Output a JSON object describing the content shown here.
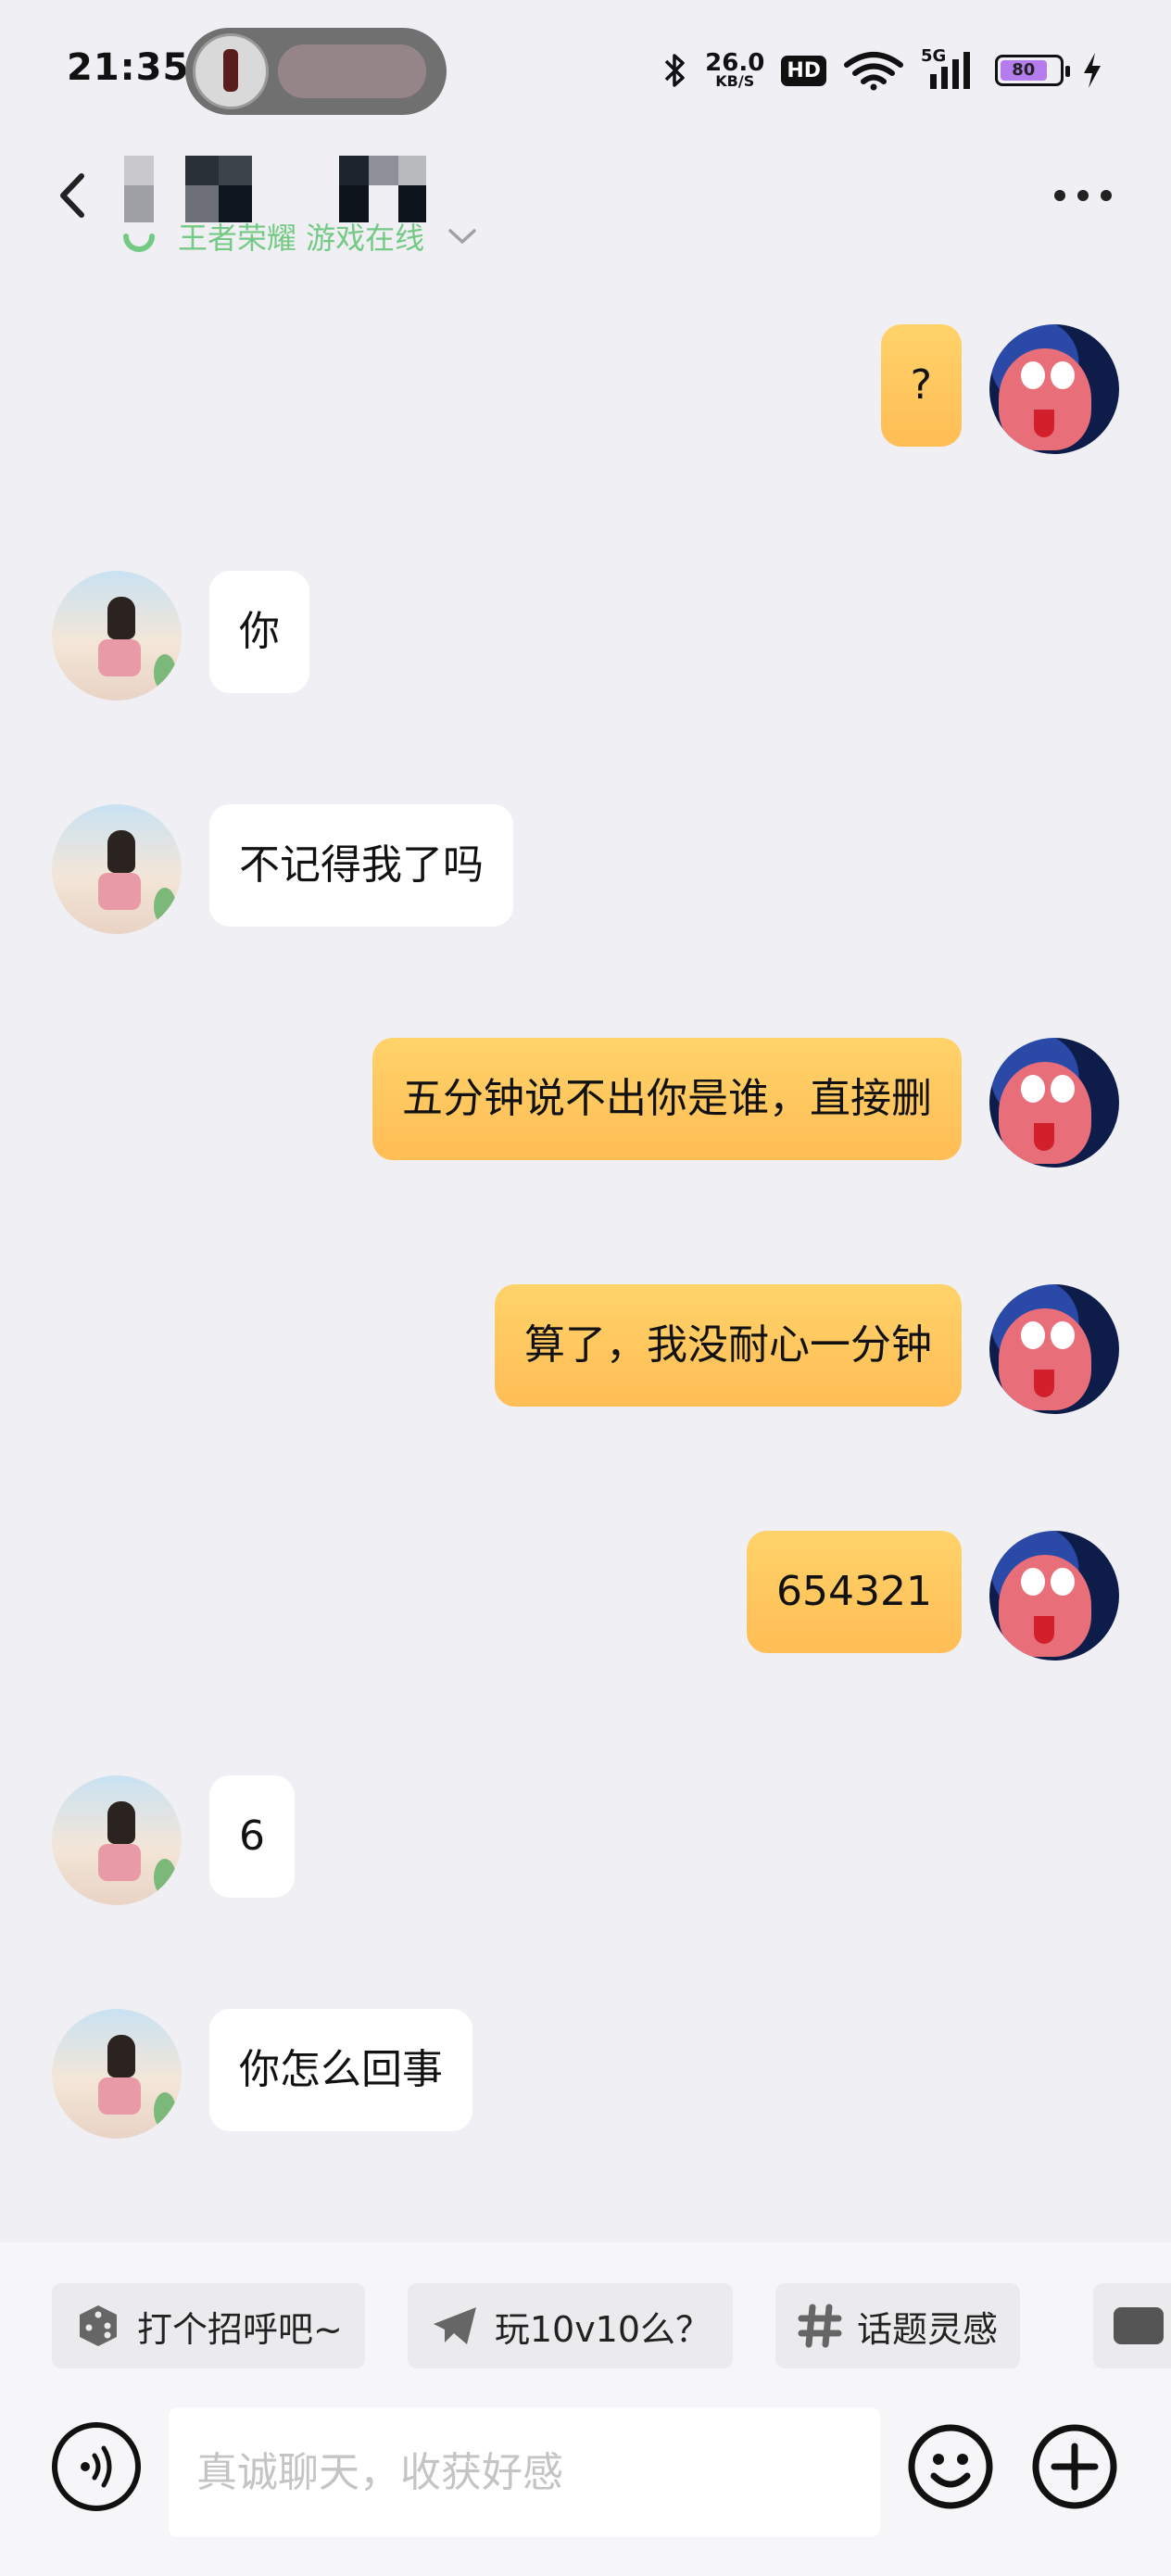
{
  "status_bar": {
    "time": "21:35",
    "net_speed": "26.0",
    "net_unit": "KB/S",
    "hd_badge": "HD",
    "signal_label": "5G",
    "battery": "80"
  },
  "header": {
    "status_text": "王者荣耀 游戏在线"
  },
  "messages": [
    {
      "side": "right",
      "text": "?"
    },
    {
      "side": "left",
      "text": "你"
    },
    {
      "side": "left",
      "text": "不记得我了吗"
    },
    {
      "side": "right",
      "text": "五分钟说不出你是谁，直接删"
    },
    {
      "side": "right",
      "text": "算了，我没耐心一分钟"
    },
    {
      "side": "right",
      "text": "654321"
    },
    {
      "side": "left",
      "text": "6"
    },
    {
      "side": "left",
      "text": "你怎么回事"
    }
  ],
  "quick_chips": [
    {
      "icon": "dice-icon",
      "label": "打个招呼吧~"
    },
    {
      "icon": "paper-plane-icon",
      "label": "玩10v10么？"
    },
    {
      "icon": "hashtag-icon",
      "label": "话题灵感"
    }
  ],
  "composer": {
    "placeholder": "真诚聊天，收获好感"
  },
  "colors": {
    "background": "#efeff4",
    "outgoing_bubble": "#ffc65e",
    "incoming_bubble": "#ffffff",
    "online_green": "#4bbe5f"
  }
}
